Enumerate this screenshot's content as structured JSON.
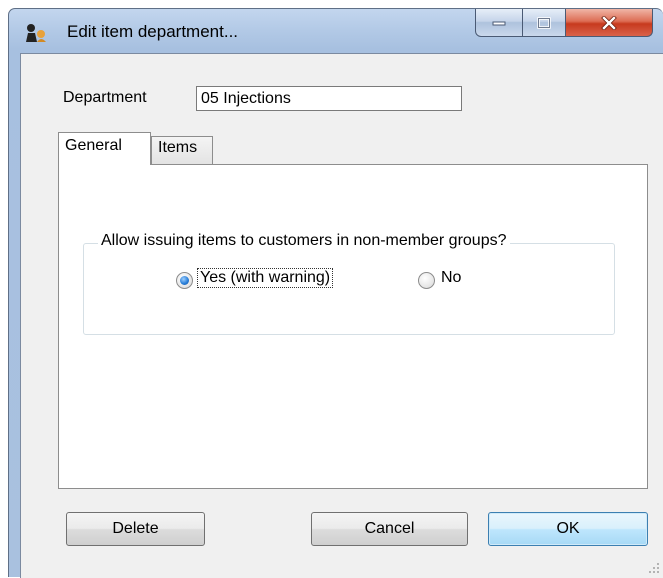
{
  "window": {
    "title": "Edit item department...",
    "icon": "app-figure-icon"
  },
  "title_bar": {
    "minimize_icon": "minimize-icon",
    "maximize_icon": "maximize-icon",
    "close_icon": "close-icon"
  },
  "form": {
    "department_label": "Department",
    "department_value": "05 Injections"
  },
  "tabs": [
    {
      "label": "General",
      "active": true
    },
    {
      "label": "Items",
      "active": false
    }
  ],
  "general_tab": {
    "group_title": "Allow issuing items to customers in non-member groups?",
    "options": [
      {
        "label": "Yes (with warning)",
        "selected": true
      },
      {
        "label": "No",
        "selected": false
      }
    ]
  },
  "buttons": {
    "delete": "Delete",
    "cancel": "Cancel",
    "ok": "OK"
  },
  "colors": {
    "accent_border": "#3c7fb1",
    "close_button": "#c73a1e",
    "frame": "#a9c1df"
  }
}
